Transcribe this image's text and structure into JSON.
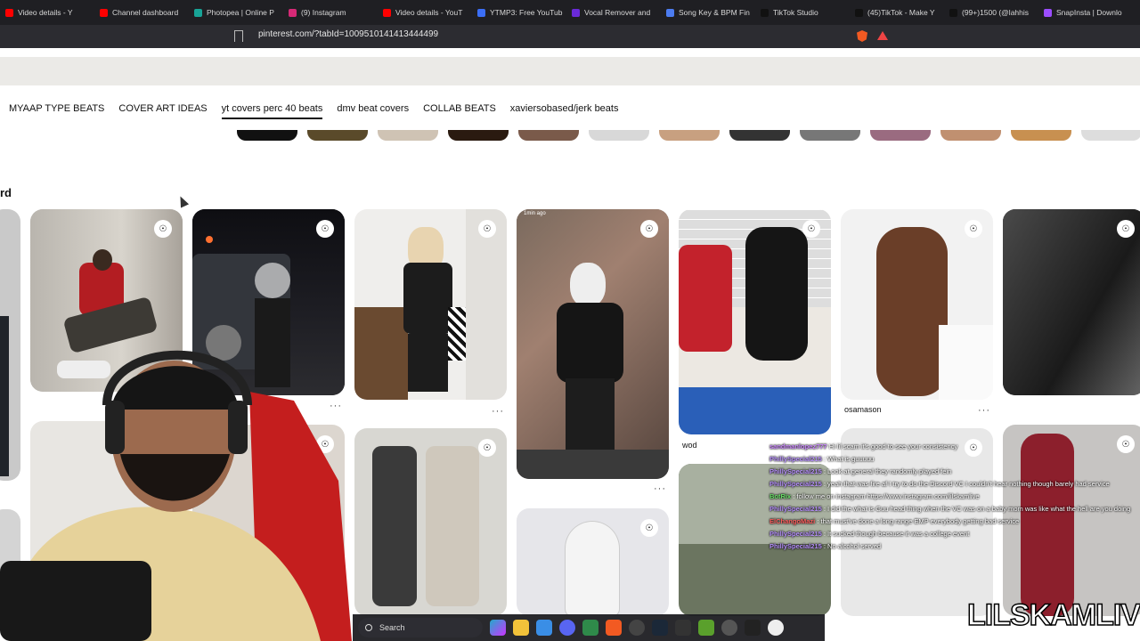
{
  "browser": {
    "tabs": [
      {
        "label": "Video details - Y",
        "color": "#ff0000"
      },
      {
        "label": "Channel dashboard",
        "color": "#ff0000"
      },
      {
        "label": "Photopea | Online P",
        "color": "#18a497"
      },
      {
        "label": "(9) Instagram",
        "color": "#d62976"
      },
      {
        "label": "Video details - YouT",
        "color": "#ff0000"
      },
      {
        "label": "YTMP3: Free YouTub",
        "color": "#3b6ef5"
      },
      {
        "label": "Vocal Remover and",
        "color": "#6a2ad8"
      },
      {
        "label": "Song Key & BPM Fin",
        "color": "#4c7cf0"
      },
      {
        "label": "TikTok Studio",
        "color": "#111111"
      },
      {
        "label": "(45)TikTok - Make Y",
        "color": "#111111"
      },
      {
        "label": "(99+)1500 (@lahhis",
        "color": "#111111"
      },
      {
        "label": "SnapInsta | Downlo",
        "color": "#9b4dff"
      }
    ],
    "url": "pinterest.com/?tabId=1009510141413444499"
  },
  "boards": {
    "tabs": [
      "MYAAP TYPE BEATS",
      "COVER ART IDEAS",
      "yt covers perc 40 beats",
      "dmv beat covers",
      "COLLAB BEATS",
      "xaviersobased/jerk beats"
    ],
    "active_index": 2
  },
  "section_title_fragment": "rd",
  "pins": {
    "captions": {
      "wod": "wod",
      "osamason": "osamason"
    },
    "timestamp": "1min ago"
  },
  "chat": {
    "lines": [
      {
        "user": "sandmanlopez777",
        "text": "Hi lil scam it's good to see your consistency"
      },
      {
        "user": "PhillySpecial215",
        "text": ": What is guuuuu"
      },
      {
        "user": "PhillySpecial215",
        "text": ": Look at general they randomly played fein"
      },
      {
        "user": "PhillySpecial215",
        "text": ": yeah that was fire af I try to do the Discord VC I couldn't hear nothing though barely had service"
      },
      {
        "user": "BotRix",
        "text": ": follow me on instagram https://www.instagram.com/lilskamlive"
      },
      {
        "user": "PhillySpecial215",
        "text": ": I did the what is Guu head thing when the VC was on a baby mom was like what the hell are you doing"
      },
      {
        "user": "ElChangoMazi",
        "text": ": that must've done a long range EMP everybody getting bad service"
      },
      {
        "user": "PhillySpecial215",
        "text": ": It sucked though because it was a college event"
      },
      {
        "user": "PhillySpecial215",
        "text": ": No alcohol served"
      }
    ]
  },
  "taskbar": {
    "search_label": "Search"
  },
  "watermark": "LILSKAMLIVE"
}
